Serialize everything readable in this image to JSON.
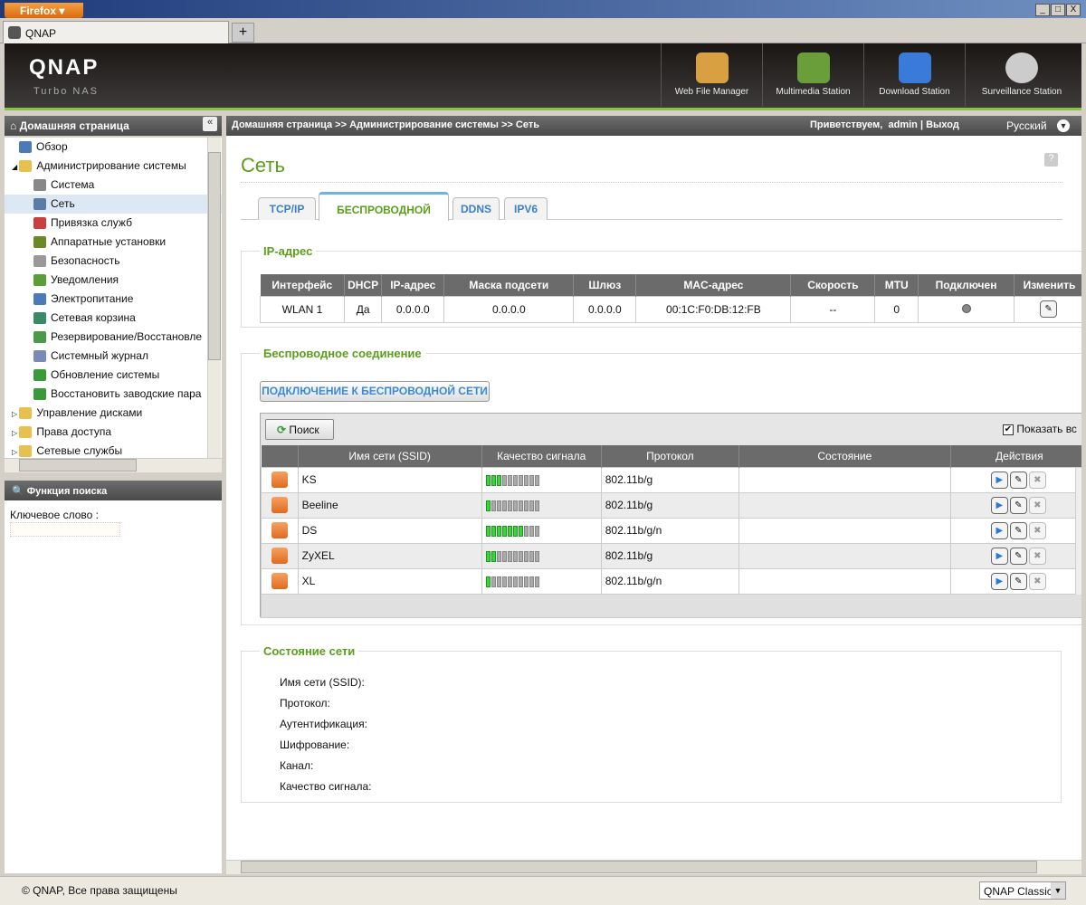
{
  "browser": {
    "menu_label": "Firefox",
    "tab_title": "QNAP",
    "new_tab": "+",
    "win_controls": [
      "_",
      "□",
      "X"
    ]
  },
  "header": {
    "logo": "QNAP",
    "sub": "Turbo NAS",
    "apps": [
      {
        "label": "Web File Manager",
        "color": "#d8a040"
      },
      {
        "label": "Multimedia Station",
        "color": "#6a9e3a"
      },
      {
        "label": "Download Station",
        "color": "#3a7ad8"
      },
      {
        "label": "Surveillance Station",
        "color": "#cccccc"
      }
    ]
  },
  "left": {
    "title": "Домашняя страница",
    "collapse": "«",
    "tree": [
      {
        "label": "Обзор",
        "level": 0,
        "color": "#4a7ab8"
      },
      {
        "label": "Администрирование системы",
        "level": 0,
        "expanded": true,
        "color": "#e8c050"
      },
      {
        "label": "Система",
        "level": 1,
        "color": "#888"
      },
      {
        "label": "Сеть",
        "level": 1,
        "selected": true,
        "color": "#5a7aa8"
      },
      {
        "label": "Привязка служб",
        "level": 1,
        "color": "#c84040"
      },
      {
        "label": "Аппаратные установки",
        "level": 1,
        "color": "#6a8a2a"
      },
      {
        "label": "Безопасность",
        "level": 1,
        "color": "#999"
      },
      {
        "label": "Уведомления",
        "level": 1,
        "color": "#5a9e3a"
      },
      {
        "label": "Электропитание",
        "level": 1,
        "color": "#4a7ab8"
      },
      {
        "label": "Сетевая корзина",
        "level": 1,
        "color": "#3a8a6a"
      },
      {
        "label": "Резервирование/Восстановле",
        "level": 1,
        "color": "#4a9a4a"
      },
      {
        "label": "Системный журнал",
        "level": 1,
        "color": "#7a8ab8"
      },
      {
        "label": "Обновление системы",
        "level": 1,
        "color": "#3a9a3a"
      },
      {
        "label": "Восстановить заводские пара",
        "level": 1,
        "color": "#3a9a3a"
      },
      {
        "label": "Управление дисками",
        "level": 0,
        "color": "#e8c050"
      },
      {
        "label": "Права доступа",
        "level": 0,
        "color": "#e8c050"
      },
      {
        "label": "Сетевые службы",
        "level": 0,
        "color": "#e8c050"
      }
    ],
    "search_title": "Функция поиска",
    "keyword_label": "Ключевое слово :",
    "keyword_value": ""
  },
  "topbar": {
    "breadcrumb": "Домашняя страница >> Администрирование системы >> Сеть",
    "greeting": "Приветствуем,",
    "user": "admin",
    "sep": "|",
    "logout": "Выход",
    "language": "Русский"
  },
  "page": {
    "title": "Сеть",
    "help": "?",
    "tabs": [
      "TCP/IP",
      "БЕСПРОВОДНОЙ",
      "DDNS",
      "IPV6"
    ],
    "active_tab": 1
  },
  "ip": {
    "legend": "IP-адрес",
    "columns": [
      "Интерфейс",
      "DHCP",
      "IP-адрес",
      "Маска подсети",
      "Шлюз",
      "MAC-адрес",
      "Скорость",
      "MTU",
      "Подключен",
      "Изменить"
    ],
    "row": [
      "WLAN 1",
      "Да",
      "0.0.0.0",
      "0.0.0.0",
      "0.0.0.0",
      "00:1C:F0:DB:12:FB",
      "--",
      "0"
    ]
  },
  "wireless": {
    "legend": "Беспроводное соединение",
    "connect_button": "ПОДКЛЮЧЕНИЕ К БЕСПРОВОДНОЙ СЕТИ",
    "search_button": "Поиск",
    "show_all_label": "Показать вс",
    "show_all_checked": true,
    "columns": [
      "",
      "Имя сети (SSID)",
      "Качество сигнала",
      "Протокол",
      "Состояние",
      "Действия"
    ],
    "networks": [
      {
        "ssid": "KS",
        "signal": 3,
        "protocol": "802.11b/g",
        "state": ""
      },
      {
        "ssid": "Beeline",
        "signal": 1,
        "protocol": "802.11b/g",
        "state": ""
      },
      {
        "ssid": "DS",
        "signal": 7,
        "protocol": "802.11b/g/n",
        "state": ""
      },
      {
        "ssid": "ZyXEL",
        "signal": 2,
        "protocol": "802.11b/g",
        "state": ""
      },
      {
        "ssid": "XL",
        "signal": 1,
        "protocol": "802.11b/g/n",
        "state": ""
      }
    ],
    "signal_max": 10
  },
  "status": {
    "legend": "Состояние сети",
    "labels": [
      "Имя сети (SSID):",
      "Протокол:",
      "Аутентификация:",
      "Шифрование:",
      "Канал:",
      "Качество сигнала:"
    ]
  },
  "footer": {
    "copyright": "© QNAP, Все права защищены",
    "theme": "QNAP Classic"
  }
}
